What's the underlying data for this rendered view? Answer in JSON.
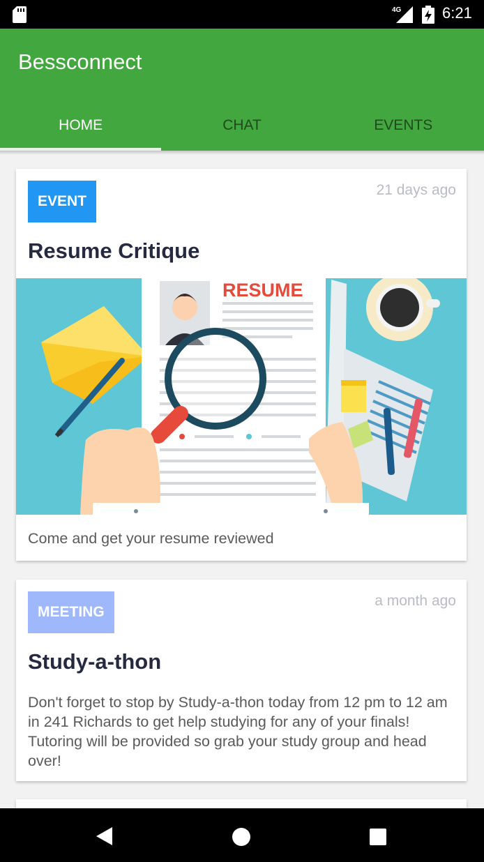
{
  "status_bar": {
    "network": "4G",
    "time": "6:21"
  },
  "app": {
    "title": "Bessconnect",
    "tabs": [
      {
        "label": "HOME",
        "active": true
      },
      {
        "label": "CHAT",
        "active": false
      },
      {
        "label": "EVENTS",
        "active": false
      }
    ]
  },
  "feed": {
    "cards": [
      {
        "badge": "EVENT",
        "badge_color": "#2196f3",
        "timestamp": "21 days ago",
        "title": "Resume Critique",
        "image_text": "RESUME",
        "description": "Come and get your resume reviewed"
      },
      {
        "badge": "MEETING",
        "badge_color": "#9fb8fb",
        "timestamp": "a month ago",
        "title": "Study-a-thon",
        "description": "Don't forget to stop by Study-a-thon today from 12 pm to 12 am in 241 Richards to get help studying for any of your finals! Tutoring will be provided so grab your study group and head over!"
      }
    ]
  },
  "colors": {
    "app_bar": "#43a73f",
    "status_bar": "#000000",
    "background": "#f2f2f2"
  },
  "icons": {
    "status_left": "sd-card-icon",
    "signal": "signal-icon",
    "battery": "battery-charging-icon",
    "nav_back": "back-icon",
    "nav_home": "home-icon",
    "nav_recents": "recents-icon"
  }
}
